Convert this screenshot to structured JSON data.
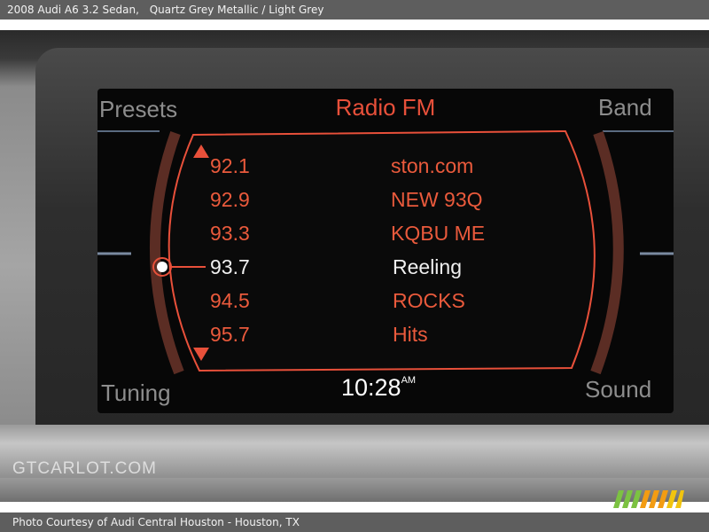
{
  "header": {
    "vehicle": "2008 Audi A6 3.2 Sedan,",
    "color": "Quartz Grey Metallic / Light Grey"
  },
  "radio": {
    "title": "Radio FM",
    "presets_label": "Presets",
    "band_label": "Band",
    "tuning_label": "Tuning",
    "sound_label": "Sound",
    "time": "10:28",
    "time_suffix": "AM",
    "stations": [
      {
        "frequency": "92.1",
        "name": "ston.com"
      },
      {
        "frequency": "92.9",
        "name": "NEW 93Q"
      },
      {
        "frequency": "93.3",
        "name": "KQBU ME"
      },
      {
        "frequency": "93.7",
        "name": "Reeling"
      },
      {
        "frequency": "94.5",
        "name": "ROCKS"
      },
      {
        "frequency": "95.7",
        "name": "Hits"
      }
    ],
    "selected_index": 3
  },
  "watermark": "GTCARLOT.COM",
  "footer": {
    "credit": "Photo Courtesy of Audi Central Houston - Houston, TX"
  },
  "colors": {
    "accent": "#ea5a3c",
    "selected": "#f0f0f0",
    "inactive_label": "#8d8d8d",
    "logo_green": "#7cc242",
    "logo_orange": "#f39c12"
  }
}
